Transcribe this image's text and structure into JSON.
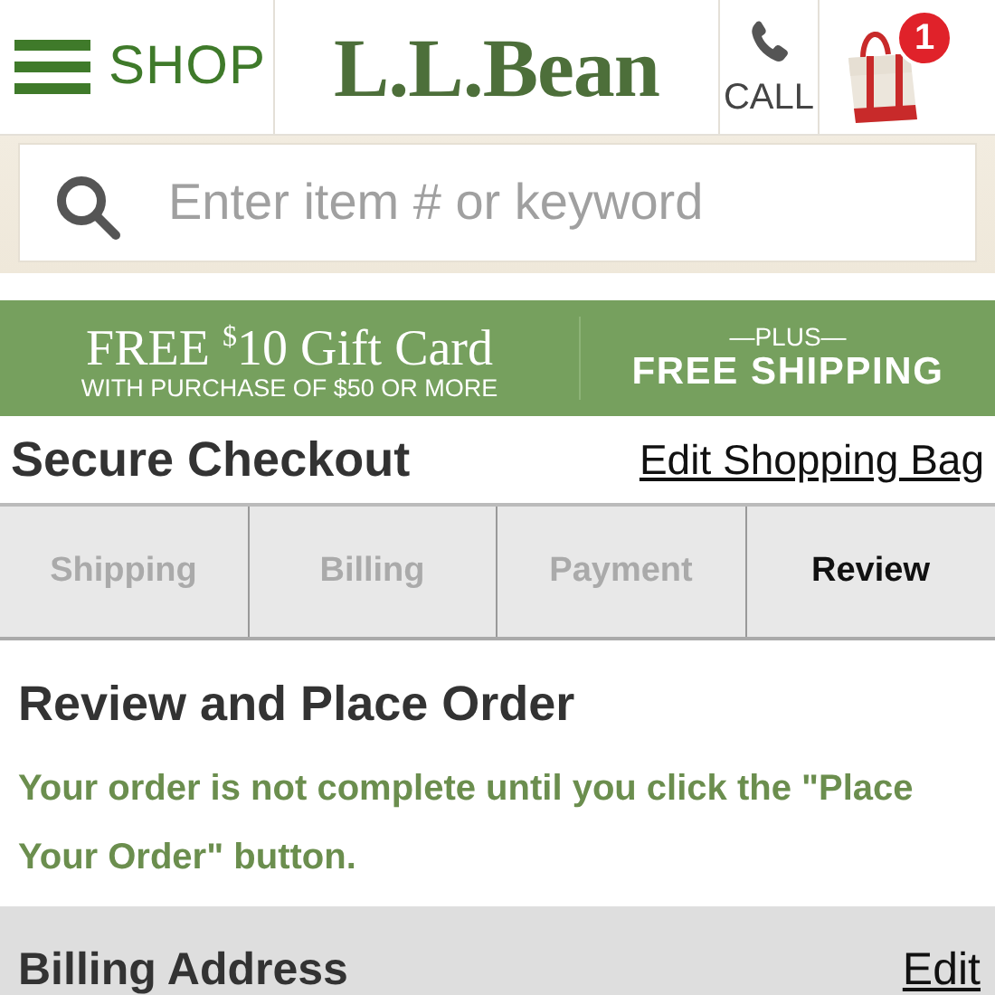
{
  "header": {
    "shop_label": "SHOP",
    "logo": "L.L.Bean",
    "call_label": "CALL",
    "cart_count": "1"
  },
  "search": {
    "placeholder": "Enter item # or keyword"
  },
  "promo": {
    "title": "FREE $^{$}$10 Gift Card",
    "subtitle": "WITH PURCHASE OF $50 OR MORE",
    "plus": "—PLUS—",
    "shipping": "FREE SHIPPING"
  },
  "checkout": {
    "title": "Secure Checkout",
    "edit_link": "Edit Shopping Bag"
  },
  "tabs": [
    {
      "label": "Shipping",
      "selected": false
    },
    {
      "label": "Billing",
      "selected": false
    },
    {
      "label": "Payment",
      "selected": false
    },
    {
      "label": "Review",
      "selected": true
    }
  ],
  "review": {
    "heading": "Review and Place Order",
    "message": "Your order is not complete until you click the \"Place Your Order\" button."
  },
  "billing": {
    "title": "Billing Address",
    "edit_link": "Edit"
  }
}
